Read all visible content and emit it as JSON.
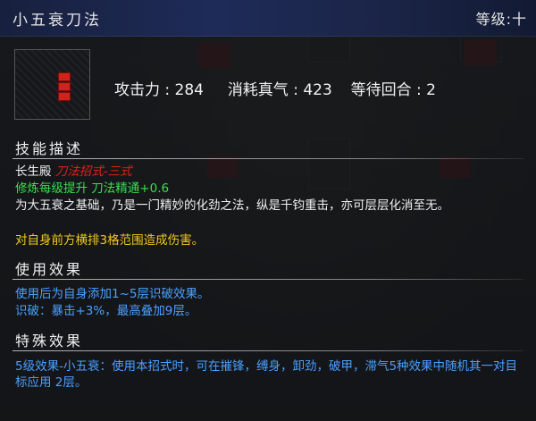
{
  "header": {
    "skill_name": "小五衰刀法",
    "level": "等级:十"
  },
  "stats": {
    "attack_label": "攻击力",
    "attack_value": "284",
    "cost_label": "消耗真气",
    "cost_value": "423",
    "cooldown_label": "等待回合",
    "cooldown_value": "2"
  },
  "description": {
    "title": "技能描述",
    "line1_prefix": "长生殿",
    "line1_red": "刀法招式-三式",
    "line2": "修炼每级提升 刀法精通+0.6",
    "line3": "为大五衰之基础，乃是一门精妙的化劲之法，纵是千钧重击，亦可层层化消至无。",
    "line4": "对自身前方横排3格范围造成伤害。"
  },
  "use_effect": {
    "title": "使用效果",
    "line1": "使用后为自身添加1~5层识破效果。",
    "line2": "识破：暴击+3%，最高叠加9层。"
  },
  "special_effect": {
    "title": "特殊效果",
    "text": "5级效果-小五衰：使用本招式时，可在摧锋，缚身，卸劲，破甲，滞气5种效果中随机其一对目标应用 2层。"
  },
  "colors": {
    "title_bar": "#1e2b58",
    "red": "#e0231b",
    "green": "#38e04c",
    "yellow": "#f2c81e",
    "blue": "#4aa0ff"
  }
}
